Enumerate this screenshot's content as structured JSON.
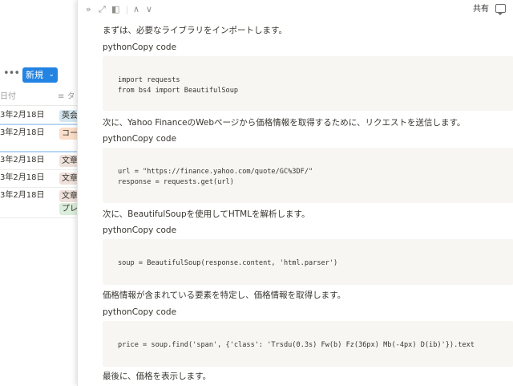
{
  "database": {
    "toolbar": {
      "more_label": "•••",
      "new_label": "新規",
      "new_chevron": "⌄"
    },
    "columns": {
      "date": "日付",
      "tags": "≡ タ"
    },
    "rows": [
      {
        "date": "3年2月18日",
        "tags": [
          "英会"
        ]
      },
      {
        "date": "3年2月18日",
        "tags": [
          "コー"
        ]
      },
      {
        "date": "3年2月18日",
        "tags": [
          "文章"
        ]
      },
      {
        "date": "3年2月18日",
        "tags": [
          "文章"
        ]
      },
      {
        "date": "3年2月18日",
        "tags": [
          "文章",
          "プレ"
        ]
      }
    ]
  },
  "peek": {
    "toolbar": {
      "close_icon": "»",
      "expand_icon": "⤢",
      "layout_icon": "◧",
      "up_icon": "∧",
      "down_icon": "∨",
      "share_label": "共有",
      "comment_icon": "comment-icon"
    },
    "blocks": [
      {
        "type": "text",
        "text": "まずは、必要なライブラリをインポートします。"
      },
      {
        "type": "label",
        "text": "pythonCopy code"
      },
      {
        "type": "code",
        "lines": [
          "import requests",
          "from bs4 import BeautifulSoup"
        ]
      },
      {
        "type": "text",
        "text": "次に、Yahoo FinanceのWebページから価格情報を取得するために、リクエストを送信します。"
      },
      {
        "type": "label",
        "text": "pythonCopy code"
      },
      {
        "type": "code",
        "lines": [
          "url = \"https://finance.yahoo.com/quote/GC%3DF/\"",
          "response = requests.get(url)"
        ]
      },
      {
        "type": "text",
        "text": "次に、BeautifulSoupを使用してHTMLを解析します。"
      },
      {
        "type": "label",
        "text": "pythonCopy code"
      },
      {
        "type": "code",
        "lines": [
          "soup = BeautifulSoup(response.content, 'html.parser')"
        ]
      },
      {
        "type": "text",
        "text": "価格情報が含まれている要素を特定し、価格情報を取得します。"
      },
      {
        "type": "label",
        "text": "pythonCopy code"
      },
      {
        "type": "code",
        "lines": [
          "price = soup.find('span', {'class': 'Trsdu(0.3s) Fw(b) Fz(36px) Mb(-4px) D(ib)'}).text"
        ]
      },
      {
        "type": "text",
        "text": "最後に、価格を表示します。"
      }
    ]
  }
}
